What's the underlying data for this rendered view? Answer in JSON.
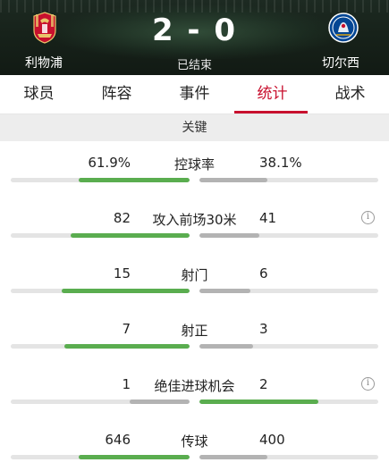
{
  "match": {
    "home_team": "利物浦",
    "away_team": "切尔西",
    "score": "2 - 0",
    "status": "已结束",
    "home_color": "#c8102e",
    "away_color": "#034694"
  },
  "tabs": [
    {
      "label": "球员",
      "active": false
    },
    {
      "label": "阵容",
      "active": false
    },
    {
      "label": "事件",
      "active": false
    },
    {
      "label": "统计",
      "active": true
    },
    {
      "label": "战术",
      "active": false
    }
  ],
  "section": {
    "title": "关键"
  },
  "colors": {
    "accent": "#c8102e",
    "leader_bar": "#5aad4f",
    "trailer_bar": "#b3b3b3",
    "track": "#e4e4e4"
  },
  "stats": [
    {
      "label": "控球率",
      "home": "61.9%",
      "away": "38.1%",
      "home_value": 61.9,
      "away_value": 38.1,
      "info": false
    },
    {
      "label": "攻入前场30米",
      "home": "82",
      "away": "41",
      "home_value": 82,
      "away_value": 41,
      "info": true
    },
    {
      "label": "射门",
      "home": "15",
      "away": "6",
      "home_value": 15,
      "away_value": 6,
      "info": false
    },
    {
      "label": "射正",
      "home": "7",
      "away": "3",
      "home_value": 7,
      "away_value": 3,
      "info": false
    },
    {
      "label": "绝佳进球机会",
      "home": "1",
      "away": "2",
      "home_value": 1,
      "away_value": 2,
      "info": true
    },
    {
      "label": "传球",
      "home": "646",
      "away": "400",
      "home_value": 646,
      "away_value": 400,
      "info": false
    }
  ],
  "icons": {
    "info": "info-icon",
    "info_glyph": "i"
  }
}
